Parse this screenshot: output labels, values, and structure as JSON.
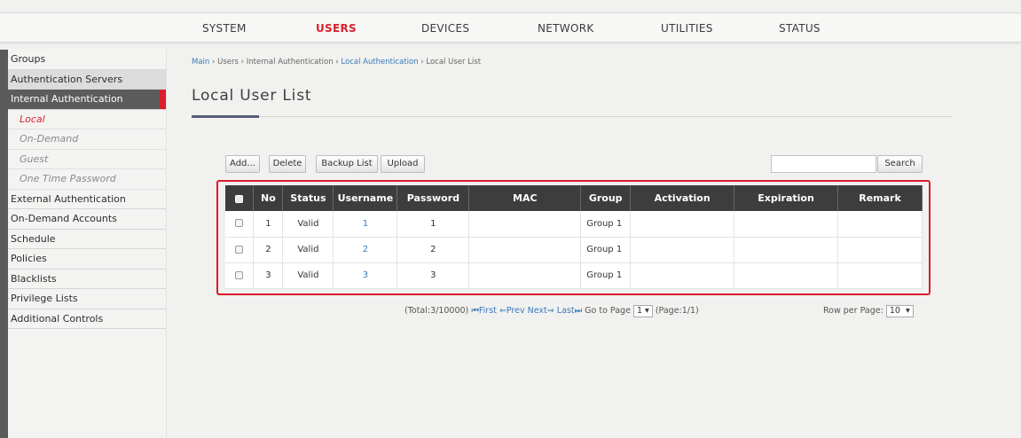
{
  "nav": [
    "SYSTEM",
    "USERS",
    "DEVICES",
    "NETWORK",
    "UTILITIES",
    "STATUS"
  ],
  "nav_active": "USERS",
  "sidebar": {
    "items": [
      {
        "label": "Groups"
      },
      {
        "label": "Authentication Servers"
      },
      {
        "label": "Internal Authentication"
      }
    ],
    "sub_items": [
      "Local",
      "On-Demand",
      "Guest",
      "One Time Password"
    ],
    "items_after": [
      "External Authentication",
      "On-Demand Accounts",
      "Schedule",
      "Policies",
      "Blacklists",
      "Privilege Lists",
      "Additional Controls"
    ]
  },
  "breadcrumb": {
    "main": "Main",
    "users": "Users",
    "internal": "Internal Authentication",
    "local": "Local Authentication",
    "current": "Local User List",
    "sep": "›"
  },
  "title": "Local User List",
  "toolbar": {
    "add": "Add...",
    "delete": "Delete",
    "backup": "Backup List",
    "upload": "Upload",
    "search": "Search",
    "search_value": ""
  },
  "table": {
    "headers": [
      "No",
      "Status",
      "Username",
      "Password",
      "MAC",
      "Group",
      "Activation",
      "Expiration",
      "Remark"
    ],
    "rows": [
      {
        "no": "1",
        "status": "Valid",
        "username": "1",
        "password": "1",
        "mac": "",
        "group": "Group 1",
        "activation": "",
        "expiration": "",
        "remark": ""
      },
      {
        "no": "2",
        "status": "Valid",
        "username": "2",
        "password": "2",
        "mac": "",
        "group": "Group 1",
        "activation": "",
        "expiration": "",
        "remark": ""
      },
      {
        "no": "3",
        "status": "Valid",
        "username": "3",
        "password": "3",
        "mac": "",
        "group": "Group 1",
        "activation": "",
        "expiration": "",
        "remark": ""
      }
    ]
  },
  "pager": {
    "total": "(Total:3/10000)",
    "first": "First",
    "prev": "Prev",
    "next": "Next",
    "last": "Last",
    "goto": "Go to Page",
    "page_value": "1",
    "page_info": "(Page:1/1)",
    "rows_label": "Row per Page:",
    "rows_value": "10"
  },
  "colors": {
    "accent": "#d81f2a",
    "link": "#3b79b8",
    "header_bg": "#3d3d3d"
  }
}
